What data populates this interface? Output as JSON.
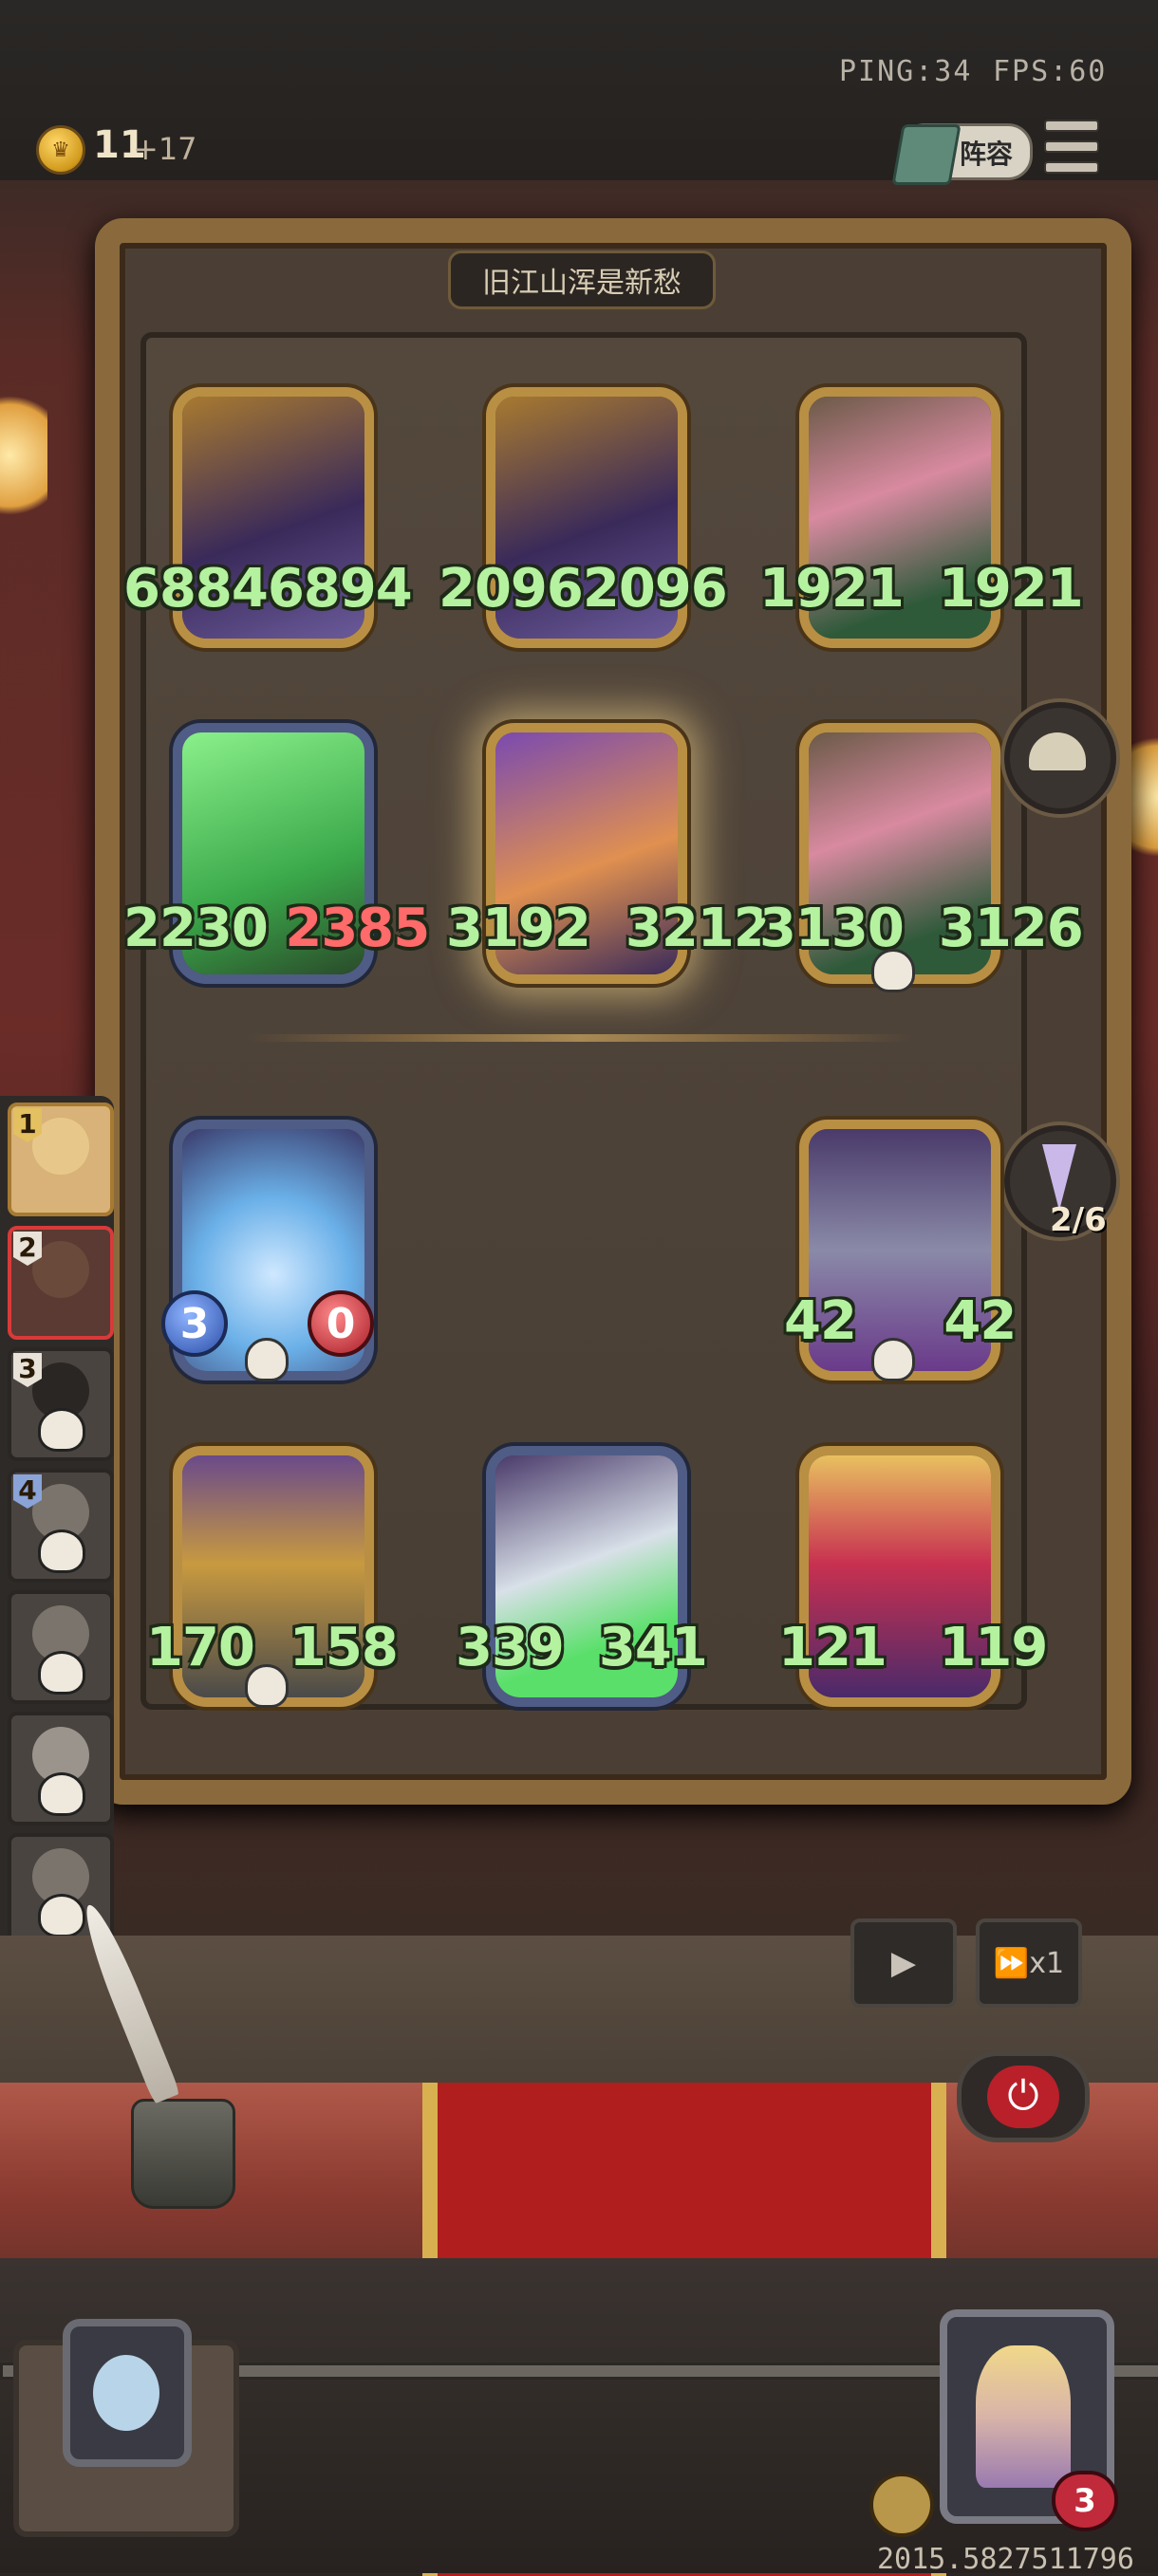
{
  "status": {
    "ping": "PING:34",
    "fps": "FPS:60"
  },
  "gold": {
    "amount": "11",
    "income": "+17"
  },
  "lineup_button": {
    "label": "阵容"
  },
  "board": {
    "title": "旧江山浑是新愁"
  },
  "enemy_units": [
    {
      "atk": "6884",
      "hp": "6894",
      "hp_damaged": false
    },
    {
      "atk": "2096",
      "hp": "2096",
      "hp_damaged": false
    },
    {
      "atk": "1921",
      "hp": "1921",
      "hp_damaged": false
    },
    {
      "atk": "2230",
      "hp": "2385",
      "hp_damaged": true
    },
    {
      "atk": "3192",
      "hp": "3212",
      "hp_damaged": false
    },
    {
      "atk": "3130",
      "hp": "3126",
      "hp_damaged": false
    }
  ],
  "player_units": [
    {
      "atk": "3",
      "hp": "0"
    },
    {
      "atk": "42",
      "hp": "42"
    },
    {
      "atk": "170",
      "hp": "158"
    },
    {
      "atk": "339",
      "hp": "341"
    },
    {
      "atk": "121",
      "hp": "119"
    }
  ],
  "spell_progress": "2/6",
  "queue": [
    {
      "rank": "1"
    },
    {
      "rank": "2"
    },
    {
      "rank": "3"
    },
    {
      "rank": "4"
    }
  ],
  "controls": {
    "play_icon": "play-icon",
    "speed_label": "x1",
    "power_icon": "power-icon"
  },
  "player": {
    "lives": "3"
  },
  "timer": "2015.5827511796",
  "colors": {
    "atk_text": "#b5f2a0",
    "damaged_text": "#ff6a6a",
    "gold_frame": "#b98f44",
    "red_runner": "#b01e1e"
  }
}
